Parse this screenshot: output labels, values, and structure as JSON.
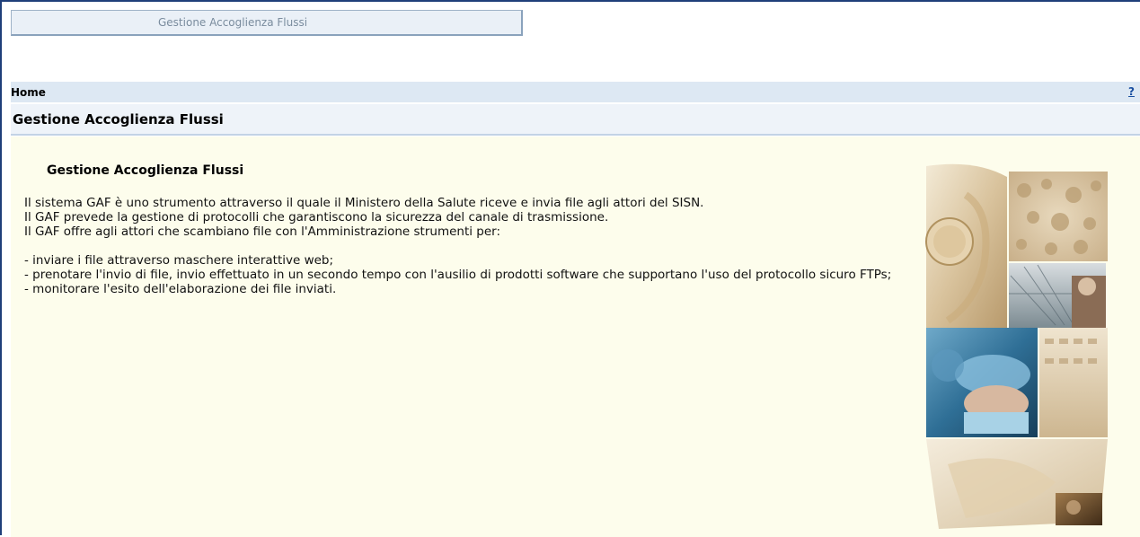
{
  "app": {
    "tab_title": "Gestione Accoglienza Flussi"
  },
  "breadcrumb": {
    "home_label": "Home",
    "help_label": "?"
  },
  "page": {
    "title": "Gestione Accoglienza Flussi"
  },
  "content": {
    "heading": "Gestione Accoglienza Flussi",
    "paragraph_lines": [
      "Il sistema GAF è uno strumento attraverso il quale il Ministero della Salute riceve e invia file agli attori del SISN.",
      "Il GAF prevede la gestione di protocolli che garantiscono la sicurezza del canale di trasmissione.",
      "Il GAF offre agli attori che scambiano file con l'Amministrazione strumenti per:"
    ],
    "list_items": [
      "- inviare i file attraverso maschere interattive web;",
      "- prenotare l'invio di file, invio effettuato in un secondo tempo con l'ausilio di prodotti software che supportano l'uso del protocollo sicuro FTPs;",
      "- monitorare l'esito dell'elaborazione dei file inviati."
    ]
  },
  "colors": {
    "content_bg": "#fdfdec",
    "header_bg": "#dde8f3",
    "title_bg": "#eef3f9",
    "link": "#1a4fa0",
    "frame": "#1f3f7a"
  },
  "icons": {
    "help": "question-mark-icon",
    "collage": "medical-photo-collage"
  }
}
